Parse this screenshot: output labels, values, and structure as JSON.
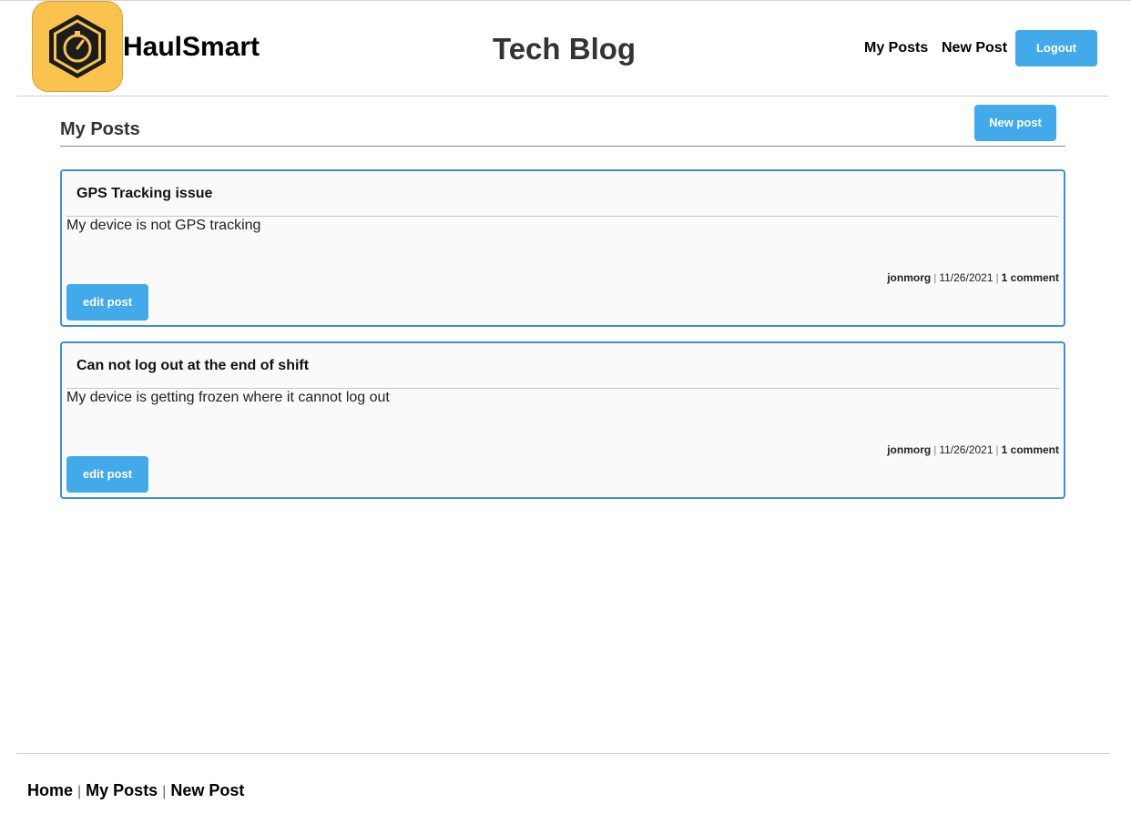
{
  "brand": {
    "name": "HaulSmart",
    "logo_icon": "stopwatch-hexagon-icon",
    "logo_color": "#f9c34e"
  },
  "site_title": "Tech Blog",
  "nav": {
    "my_posts": "My Posts",
    "new_post": "New Post",
    "logout": "Logout"
  },
  "accent_color": "#42aaea",
  "dashboard": {
    "title": "My Posts",
    "new_post_button": "New post"
  },
  "posts": [
    {
      "title": "GPS Tracking issue",
      "body": "My device is not GPS tracking",
      "author": "jonmorg",
      "date": "11/26/2021",
      "comments": "1 comment",
      "edit_label": "edit post"
    },
    {
      "title": "Can not log out at the end of shift",
      "body": "My device is getting frozen where it cannot log out",
      "author": "jonmorg",
      "date": "11/26/2021",
      "comments": "1 comment",
      "edit_label": "edit post"
    }
  ],
  "footer": {
    "home": "Home",
    "my_posts": "My Posts",
    "new_post": "New Post",
    "separator": "|"
  },
  "meta_separator": "|"
}
